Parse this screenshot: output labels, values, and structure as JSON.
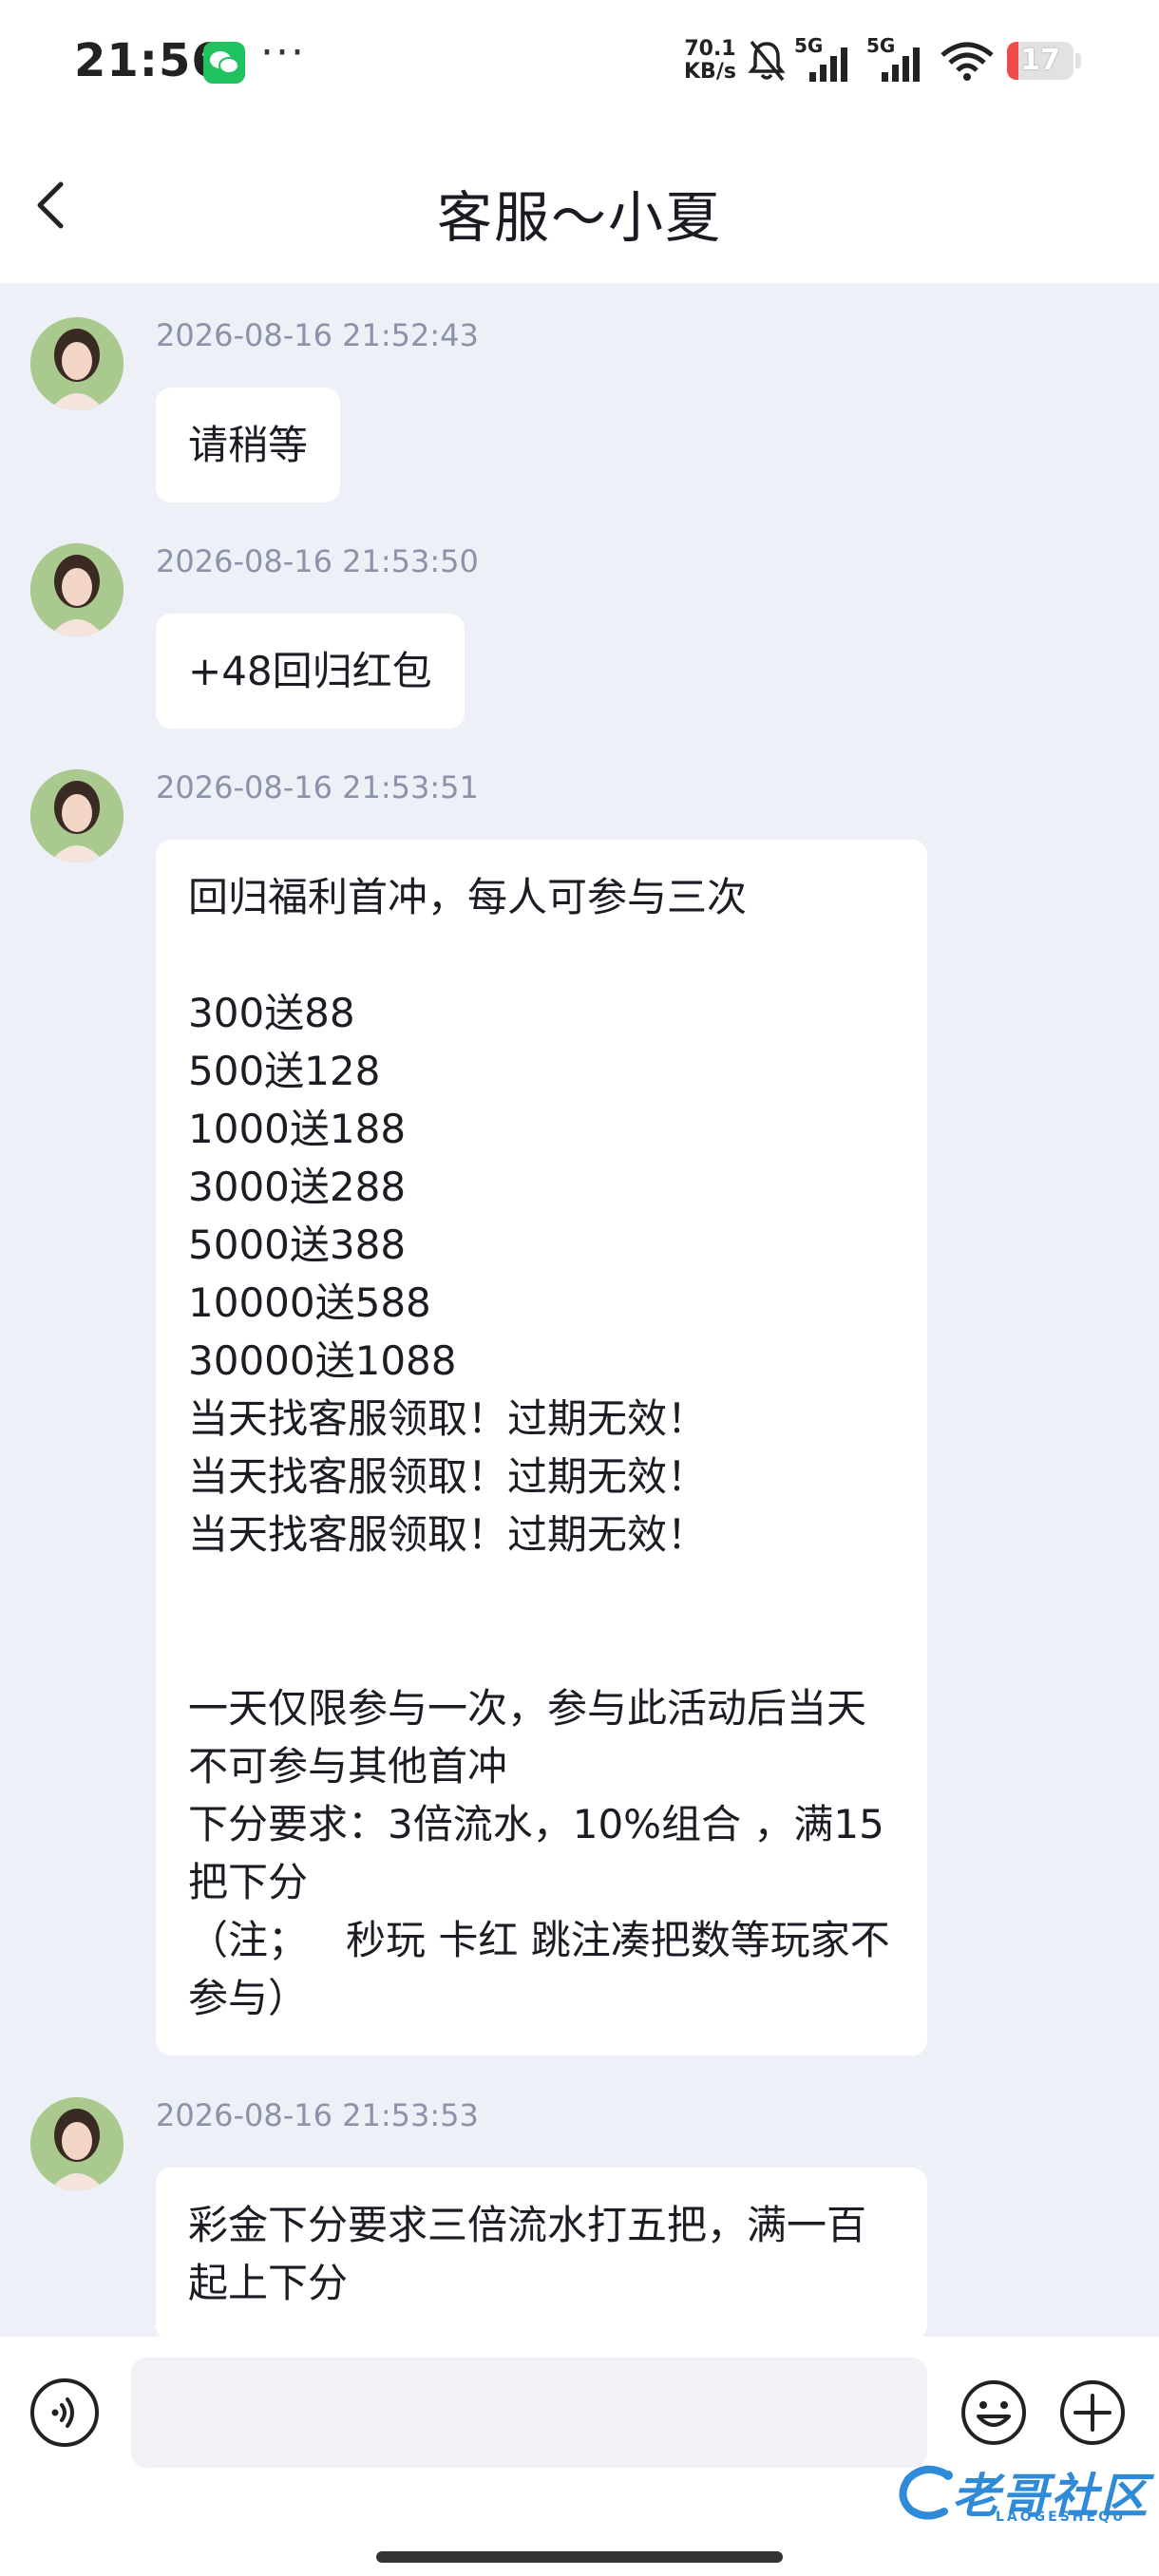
{
  "status_bar": {
    "time": "21:56",
    "more": "···",
    "net_speed_value": "70.1",
    "net_speed_unit": "KB/s",
    "signal_1_label": "5G",
    "signal_2_label": "5G",
    "battery_level": "17",
    "icons": [
      "wechat-icon",
      "bell-off-icon",
      "signal-icon",
      "signal-icon",
      "wifi-icon",
      "battery-icon"
    ]
  },
  "header": {
    "title": "客服～小夏",
    "back_icon": "chevron-left-icon"
  },
  "messages": [
    {
      "timestamp": "2026-08-16 21:52:43",
      "text": "请稍等"
    },
    {
      "timestamp": "2026-08-16 21:53:50",
      "text": "+48回归红包"
    },
    {
      "timestamp": "2026-08-16 21:53:51",
      "text": "回归福利首冲，每人可参与三次\n\n300送88\n500送128\n1000送188\n3000送288\n5000送388\n10000送588\n30000送1088\n当天找客服领取！过期无效！\n当天找客服领取！过期无效！\n当天找客服领取！过期无效！\n\n\n一天仅限参与一次，参与此活动后当天不可参与其他首冲\n下分要求：3倍流水，10%组合 ，满15把下分\n（注；   秒玩 卡红 跳注凑把数等玩家不参与）"
    },
    {
      "timestamp": "2026-08-16 21:53:53",
      "text": "彩金下分要求三倍流水打五把，满一百起上下分"
    }
  ],
  "input_bar": {
    "placeholder": "",
    "value": "",
    "icons": [
      "voice-icon",
      "emoji-icon",
      "plus-icon"
    ]
  },
  "watermark": {
    "text": "老哥社区",
    "sub": "LAOGESHEQU"
  },
  "colors": {
    "chat_background": "#eef0f8",
    "bubble_background": "#ffffff",
    "timestamp": "#8a93a8",
    "battery_low": "#ef4b4b",
    "wechat_green": "#1fc25e"
  }
}
